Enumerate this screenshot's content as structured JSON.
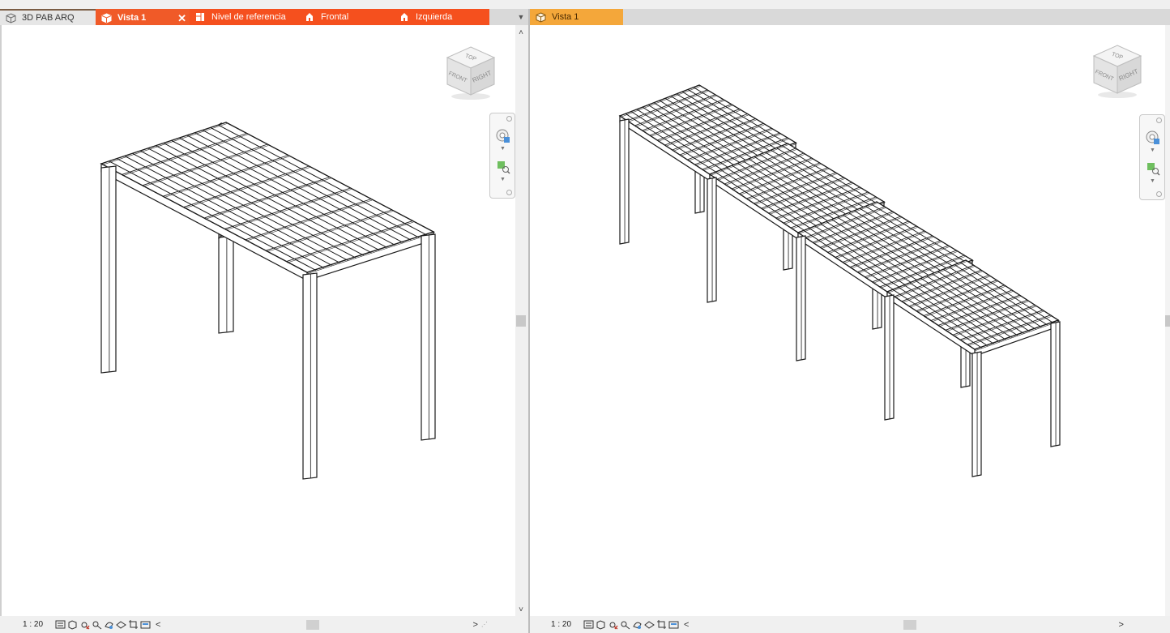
{
  "tabs_left": [
    {
      "label": "3D PAB ARQ",
      "icon": "3d-view-icon"
    },
    {
      "label": "Vista 1",
      "icon": "3d-view-icon"
    },
    {
      "label": "Nivel de referencia",
      "icon": "floor-plan-icon"
    },
    {
      "label": "Frontal",
      "icon": "elevation-icon"
    },
    {
      "label": "Izquierda",
      "icon": "elevation-icon"
    }
  ],
  "tabs_right": [
    {
      "label": "Vista 1",
      "icon": "3d-view-icon"
    }
  ],
  "close_glyph": "✕",
  "tab_menu_glyph": "▼",
  "viewcube": {
    "top": "TOP",
    "front": "FRONT",
    "right": "RIGHT"
  },
  "status_left": {
    "scale": "1 : 20",
    "scroll_left": "<",
    "scroll_right": ">"
  },
  "status_right": {
    "scale": "1 : 20",
    "scroll_left": "<",
    "scroll_right": ">"
  },
  "scroll_up": "˄",
  "scroll_down": "˅",
  "colors": {
    "active_tab": "#f05a28",
    "orange_tab": "#f5501e",
    "secondary_tab": "#f4a73a",
    "model_lines": "#1a1a1a"
  },
  "status_icons": [
    "detail-level-icon",
    "visual-style-icon",
    "sun-path-icon",
    "shadows-icon",
    "render-icon",
    "crop-view-icon",
    "show-crop-icon",
    "unlock-3d-icon",
    "temp-hide-icon"
  ]
}
